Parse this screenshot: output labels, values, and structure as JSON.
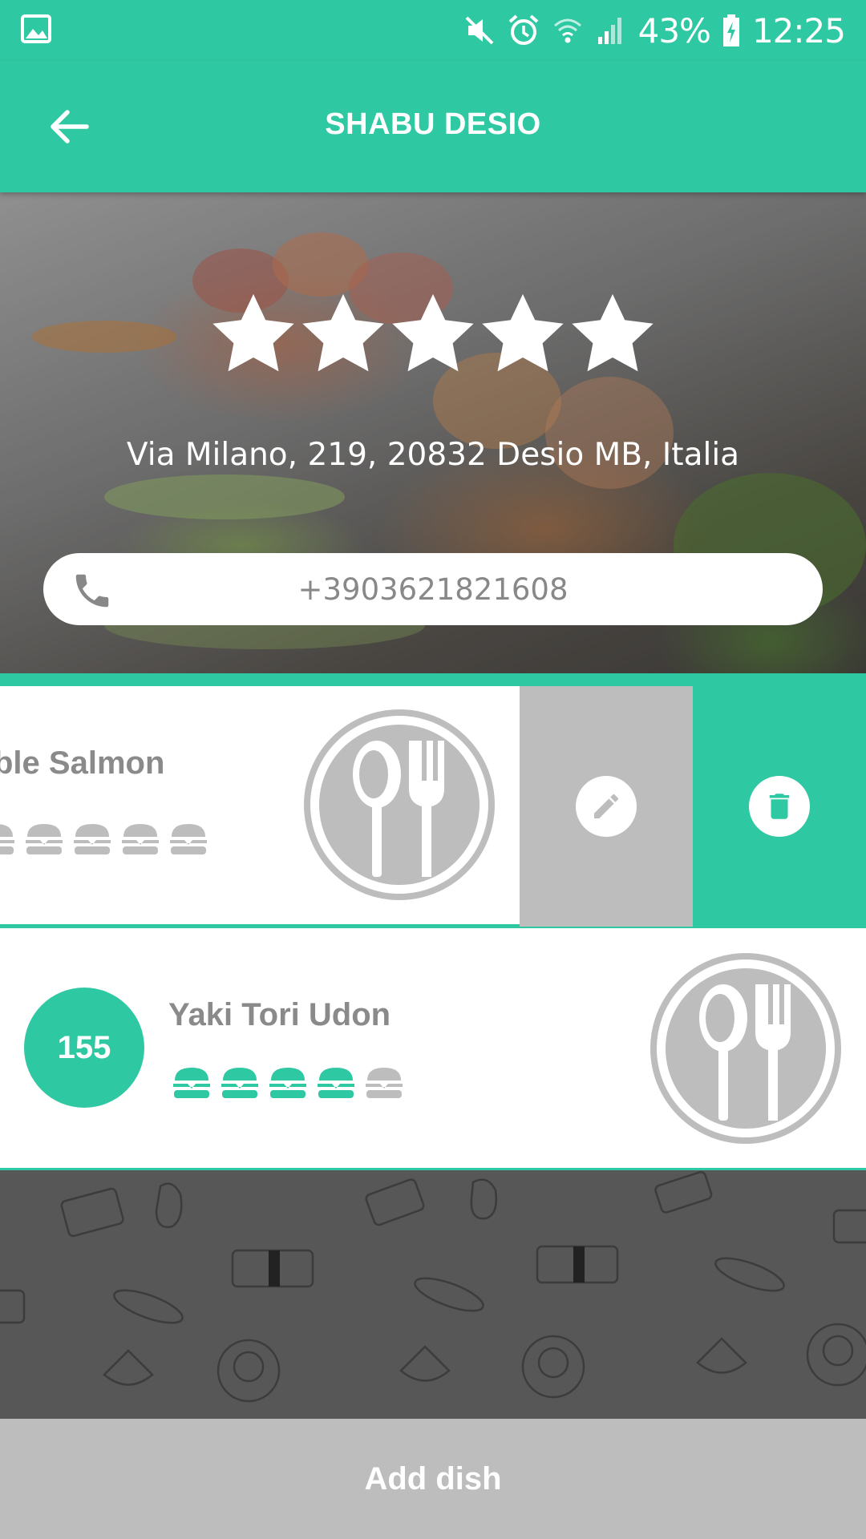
{
  "status_bar": {
    "battery": "43%",
    "time": "12:25"
  },
  "header": {
    "title": "SHABU DESIO"
  },
  "restaurant": {
    "rating": 5,
    "rating_max": 5,
    "address": "Via Milano, 219, 20832 Desio MB, Italia",
    "phone": "+3903621821608"
  },
  "dishes": [
    {
      "visible_name": "ble Salmon",
      "rating": 5,
      "actions": [
        "edit",
        "delete"
      ]
    },
    {
      "number": "155",
      "name": "Yaki Tori Udon",
      "rating": 4,
      "rating_max": 5
    }
  ],
  "footer": {
    "add_label": "Add dish"
  },
  "colors": {
    "accent": "#2ec8a2",
    "muted": "#bdbdbd",
    "text_gray": "#8a8a8a",
    "background_dark": "#575757"
  }
}
